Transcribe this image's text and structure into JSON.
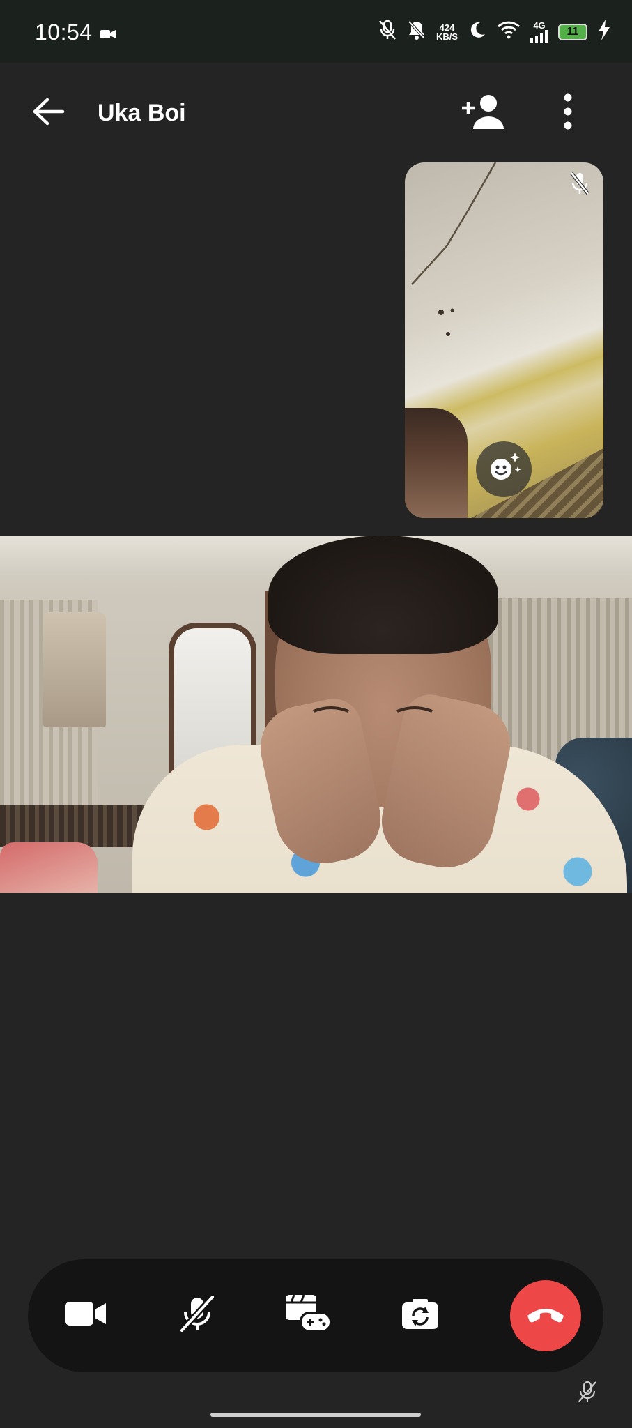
{
  "status_bar": {
    "time": "10:54",
    "net_speed_value": "424",
    "net_speed_unit": "KB/S",
    "network_type": "4G",
    "battery_level": "11",
    "icons": [
      "video-recording-icon",
      "mic-muted-icon",
      "notifications-off-icon",
      "dnd-moon-icon",
      "wifi-icon",
      "signal-icon",
      "battery-icon",
      "charging-icon"
    ]
  },
  "app_bar": {
    "title": "Uka Boi",
    "icons": [
      "back-arrow-icon",
      "add-person-icon",
      "more-vert-icon"
    ]
  },
  "self_view": {
    "icons": [
      "mic-muted-icon",
      "effects-sparkle-icon"
    ]
  },
  "call_controls": {
    "icons": [
      "video-camera-icon",
      "mic-off-icon",
      "games-icon",
      "flip-camera-icon",
      "end-call-icon"
    ],
    "end_call_color": "#ee4747"
  },
  "footer": {
    "icons": [
      "mic-muted-icon"
    ]
  },
  "colors": {
    "background": "#242424",
    "status_bar": "#1b211c",
    "control_bar": "#141414"
  }
}
